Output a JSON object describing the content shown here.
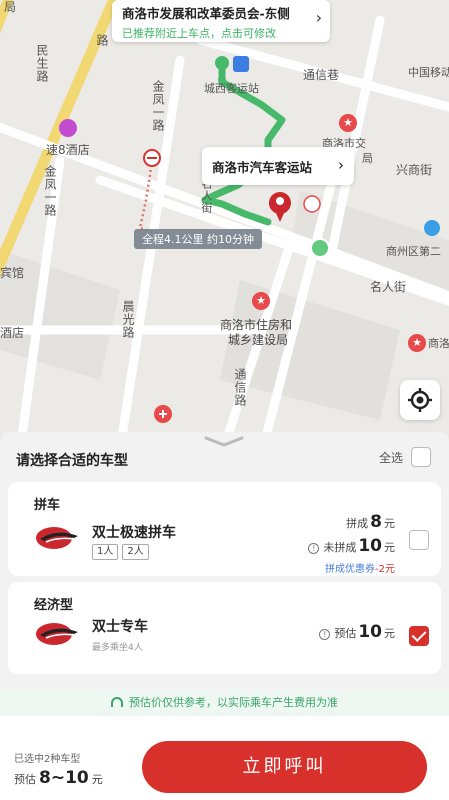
{
  "map": {
    "pickup_card": {
      "title": "商洛市发展和改革委员会-东侧",
      "hint": "已推荐附近上车点，点击可修改"
    },
    "destination_card": {
      "title": "商洛市汽车客运站"
    },
    "route_info": "全程4.1公里  约10分钟",
    "labels": {
      "tongxin_lane": "通信巷",
      "china_mobile": "中国移动",
      "shangluo_jiao": "商洛市交",
      "ju": "局",
      "xingshang_st": "兴商街",
      "su8": "速8酒店",
      "shangzhou_2": "商州区第二",
      "mingren_st": "名人街",
      "housing1": "商洛市住房和",
      "housing2": "城乡建设局",
      "shang_right": "商洛",
      "bus_station_map": "城西客运站",
      "binguan": "宾馆",
      "jiudian": "酒店",
      "mingren_v": "名人街",
      "minsheng_rd": "民生路",
      "jinfeng_rd": "金凤一路",
      "jinfeng_rd2": "金凤一路",
      "chenguang_rd": "晨光路",
      "tongxin_rd": "通信路",
      "ju_top": "局",
      "lu_top": "路"
    },
    "colors": {
      "route": "#46b96a",
      "dest": "#c9282e",
      "bg": "#eceae6"
    }
  },
  "panel": {
    "title": "请选择合适的车型",
    "select_all_label": "全选",
    "carpool": {
      "category": "拼车",
      "name": "双士极速拼车",
      "seat_options": [
        "1人",
        "2人"
      ],
      "shared_label": "拼成",
      "shared_price": "8",
      "unshared_label": "未拼成",
      "unshared_price": "10",
      "currency": "元",
      "coupon_label": "拼成优惠券",
      "coupon_value": "-2",
      "selected": false
    },
    "economy": {
      "category": "经济型",
      "name": "双士专车",
      "capacity": "最多乘坐4人",
      "estimate_label": "预估",
      "price": "10",
      "currency": "元",
      "selected": true
    },
    "notice": "预估价仅供参考，以实际乘车产生费用为准"
  },
  "footer": {
    "selected_text": "已选中2种车型",
    "estimate_label": "预估",
    "estimate_range": "8~10",
    "currency": "元",
    "call_button": "立即呼叫"
  }
}
